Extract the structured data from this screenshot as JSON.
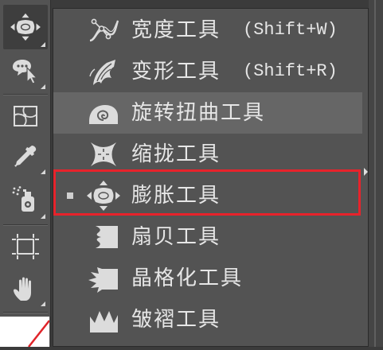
{
  "colors": {
    "panel_bg": "#535353",
    "backdrop": "#3b3b3b",
    "text": "#e6e6e6",
    "hover_bg": "#666666",
    "active_tool_bg": "#3e3e3e",
    "annotation_red": "#e8232b",
    "icon": "#dcdcdc"
  },
  "toolbar": {
    "tools": [
      {
        "icon": "bloat-tool-icon",
        "active": true,
        "has_flyout": true
      },
      {
        "icon": "shape-builder-tool-icon",
        "active": false,
        "has_flyout": true
      },
      {
        "icon": "mesh-tool-icon",
        "active": false,
        "has_flyout": false
      },
      {
        "icon": "eyedropper-tool-icon",
        "active": false,
        "has_flyout": true
      },
      {
        "icon": "symbol-sprayer-tool-icon",
        "active": false,
        "has_flyout": true
      },
      {
        "icon": "artboard-tool-icon",
        "active": false,
        "has_flyout": false
      },
      {
        "icon": "hand-tool-icon",
        "active": false,
        "has_flyout": true
      }
    ],
    "fill_swatch": {
      "color": "#ffffff",
      "slash_color": "#e0242a"
    }
  },
  "flyout": {
    "items": [
      {
        "label": "宽度工具",
        "shortcut": "(Shift+W)",
        "icon": "width-tool-icon"
      },
      {
        "label": "变形工具",
        "shortcut": "(Shift+R)",
        "icon": "warp-tool-icon"
      },
      {
        "label": "旋转扭曲工具",
        "icon": "twirl-tool-icon",
        "hovered": true
      },
      {
        "label": "缩拢工具",
        "icon": "pucker-tool-icon"
      },
      {
        "label": "膨胀工具",
        "icon": "bloat-tool-icon",
        "current": true
      },
      {
        "label": "扇贝工具",
        "icon": "scallop-tool-icon"
      },
      {
        "label": "晶格化工具",
        "icon": "crystallize-tool-icon"
      },
      {
        "label": "皱褶工具",
        "icon": "wrinkle-tool-icon"
      }
    ],
    "annotation": {
      "target_index": 4,
      "color": "#e8232b"
    }
  }
}
